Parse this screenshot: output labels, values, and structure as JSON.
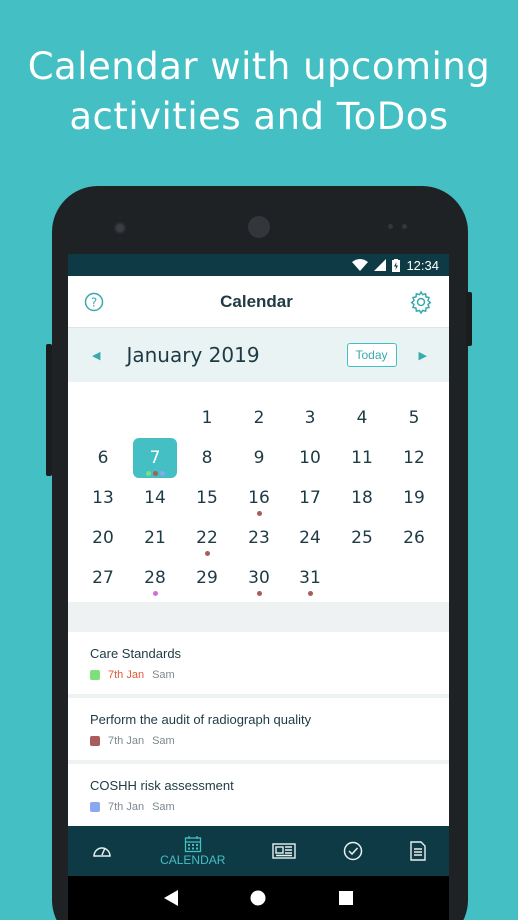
{
  "headline": {
    "line1": "Calendar with upcoming",
    "line2": "activities and ToDos"
  },
  "statusbar": {
    "time": "12:34",
    "icons": [
      "wifi-icon",
      "signal-icon",
      "battery-icon"
    ]
  },
  "appbar": {
    "title": "Calendar",
    "left_icon": "help-icon",
    "right_icon": "gear-icon"
  },
  "month": {
    "title": "January 2019",
    "today_label": "Today"
  },
  "colors": {
    "accent": "#44bfc4",
    "dark": "#0e3a45",
    "green": "#7ee07a",
    "brown": "#a85c5c",
    "purple": "#d06fd8",
    "blue": "#8aa8f0",
    "orange": "#e0593a"
  },
  "calendar": {
    "selected_day": "7",
    "days": [
      {
        "d": "1"
      },
      {
        "d": "2"
      },
      {
        "d": "3"
      },
      {
        "d": "4"
      },
      {
        "d": "5"
      },
      {
        "d": "6"
      },
      {
        "d": "7"
      },
      {
        "d": "8"
      },
      {
        "d": "9"
      },
      {
        "d": "10"
      },
      {
        "d": "11"
      },
      {
        "d": "12"
      },
      {
        "d": "13"
      },
      {
        "d": "14"
      },
      {
        "d": "15"
      },
      {
        "d": "16"
      },
      {
        "d": "17"
      },
      {
        "d": "18"
      },
      {
        "d": "19"
      },
      {
        "d": "20"
      },
      {
        "d": "21"
      },
      {
        "d": "22"
      },
      {
        "d": "23"
      },
      {
        "d": "24"
      },
      {
        "d": "25"
      },
      {
        "d": "26"
      },
      {
        "d": "27"
      },
      {
        "d": "28"
      },
      {
        "d": "29"
      },
      {
        "d": "30"
      },
      {
        "d": "31"
      }
    ],
    "markers": {
      "7": [
        "#7ee07a",
        "#a85c5c",
        "#8aa8f0"
      ],
      "16": [
        "#a85c5c"
      ],
      "22": [
        "#a85c5c"
      ],
      "28": [
        "#d06fd8"
      ],
      "30": [
        "#a85c5c"
      ],
      "31": [
        "#a85c5c"
      ]
    }
  },
  "tasks": [
    {
      "title": "Care Standards",
      "date": "7th Jan",
      "person": "Sam",
      "color": "#7ee07a",
      "date_color": "#e0593a"
    },
    {
      "title": "Perform the audit of radiograph quality",
      "date": "7th Jan",
      "person": "Sam",
      "color": "#a85c5c",
      "date_color": "#7c8a8e"
    },
    {
      "title": "COSHH risk assessment",
      "date": "7th Jan",
      "person": "Sam",
      "color": "#8aa8f0",
      "date_color": "#7c8a8e"
    }
  ],
  "bottomnav": {
    "active_label": "CALENDAR"
  }
}
